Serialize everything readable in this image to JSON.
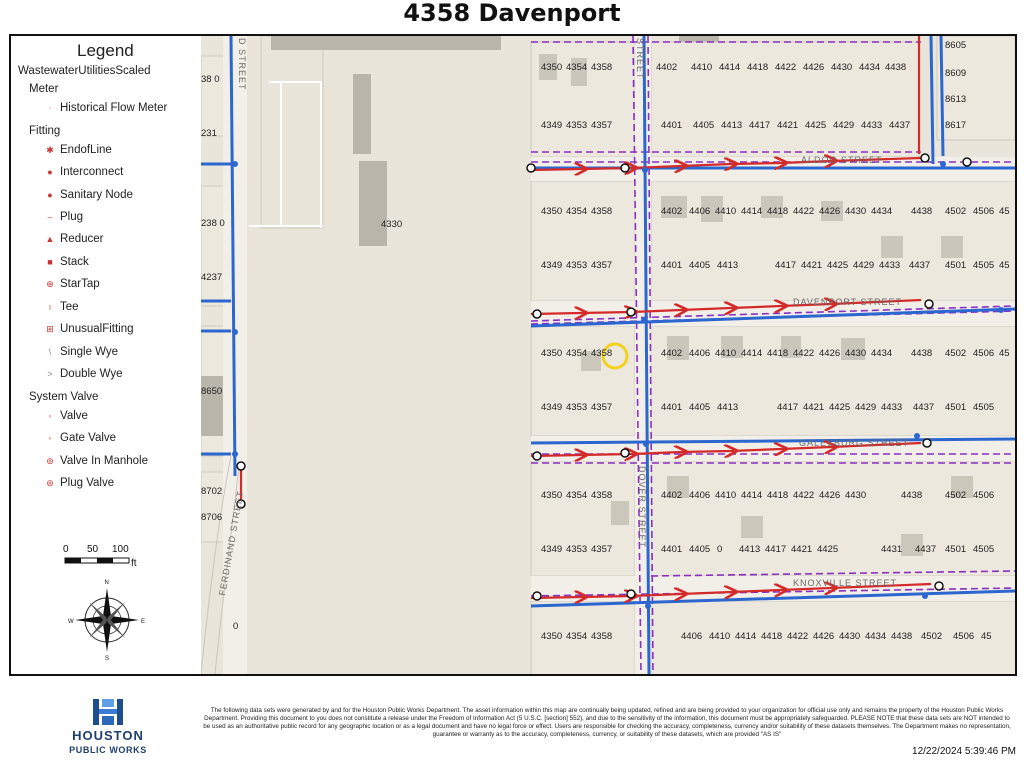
{
  "title": "4358 Davenport",
  "legend": {
    "heading": "Legend",
    "layer": "WastewaterUtilitiesScaled",
    "groups": [
      {
        "name": "Meter",
        "items": [
          "Historical Flow Meter"
        ]
      },
      {
        "name": "Fitting",
        "items": [
          "EndofLine",
          "Interconnect",
          "Sanitary Node",
          "Plug",
          "Reducer",
          "Stack",
          "StarTap",
          "Tee",
          "UnusualFitting",
          "Single Wye",
          "Double Wye"
        ]
      },
      {
        "name": "System Valve",
        "items": [
          "Valve",
          "Gate Valve",
          "Valve In Manhole",
          "Plug Valve"
        ]
      }
    ],
    "scale": {
      "t0": "0",
      "t50": "50",
      "t100": "100",
      "unit": "ft"
    },
    "compass": {
      "n": "N",
      "s": "S",
      "e": "E",
      "w": "W"
    }
  },
  "streets": {
    "aldoo": "ALDOO STREET",
    "davenport": "DAVENPORT STREET",
    "galesburg": "GALESBURG STREET",
    "knoxville": "KNOXVILLE STREET",
    "ferdinand": "FERDINAND STREET",
    "ferdinand_top": "D STREET",
    "cross": "STREET",
    "cross2": "DOVER STREET"
  },
  "parcels": {
    "left_col": [
      "38 0",
      "231",
      "238 0",
      "4237",
      "8650",
      "8702",
      "8706"
    ],
    "center": "4330",
    "bottom_left": "0",
    "right_col": [
      "8605",
      "8609",
      "8613",
      "8617"
    ],
    "row1": [
      "4350",
      "4354",
      "4358",
      "4402",
      "4410",
      "4414",
      "4418",
      "4422",
      "4426",
      "4430",
      "4434",
      "4438"
    ],
    "row2": [
      "4349",
      "4353",
      "4357",
      "4401",
      "4405",
      "4413",
      "4417",
      "4421",
      "4425",
      "4429",
      "4433",
      "4437"
    ],
    "row3": [
      "4350",
      "4354",
      "4358",
      "4402",
      "4406",
      "4410",
      "4414",
      "4418",
      "4422",
      "4426",
      "4430",
      "4434",
      "4438",
      "4502",
      "4506",
      "45"
    ],
    "row4": [
      "4349",
      "4353",
      "4357",
      "4401",
      "4405",
      "4413",
      "4417",
      "4421",
      "4425",
      "4429",
      "4433",
      "4437",
      "4501",
      "4505",
      "45"
    ],
    "row5": [
      "4350",
      "4354",
      "4358",
      "4402",
      "4406",
      "4410",
      "4414",
      "4418",
      "4422",
      "4426",
      "4430",
      "4434",
      "4438",
      "4502",
      "4506",
      "45"
    ],
    "row6": [
      "4349",
      "4353",
      "4357",
      "4401",
      "4405",
      "4413",
      "4417",
      "4421",
      "4425",
      "4429",
      "4433",
      "4437",
      "4501",
      "4505"
    ],
    "row7": [
      "4350",
      "4354",
      "4358",
      "4402",
      "4406",
      "4410",
      "4414",
      "4418",
      "4422",
      "4426",
      "4430",
      "4438",
      "4502",
      "4506"
    ],
    "row8": [
      "4349",
      "4353",
      "4357",
      "4401",
      "4405",
      "0",
      "4413",
      "4417",
      "4421",
      "4425",
      "4431",
      "4437",
      "4501",
      "4505"
    ],
    "row9": [
      "4350",
      "4354",
      "4358",
      "4406",
      "4410",
      "4414",
      "4418",
      "4422",
      "4426",
      "4430",
      "4434",
      "4438",
      "4502",
      "4506",
      "45"
    ]
  },
  "colors": {
    "ground": "#e9e5da",
    "lot": "#ede9df",
    "building": "#b9b5aa",
    "red_line": "#d32a2a",
    "blue_line": "#2c67cf",
    "purple_dash": "#8a2fc4",
    "highlight": "#f2d21c"
  },
  "footer": {
    "logo_top": "HOUSTON",
    "logo_bottom": "PUBLIC WORKS",
    "disclaimer": "The following data sets were generated by and for the Houston Public Works Department. The asset information within this map are continually being updated, refined and are being provided to your organization for official use only and remains the property of the Houston Public Works Department. Providing this document to you does not constitute a release under the Freedom of Information Act (5 U.S.C. [section] 552), and due to the sensitivity of the information, this document must be appropriately safeguarded. PLEASE NOTE that these data sets are NOT intended to be used as an authoritative public record for any geographic location or as a legal document and have no legal force or effect. Users are responsible for checking the accuracy, completeness, currency and/or suitability of these datasets themselves. The Department makes no representation, guarantee or warranty as to the accuracy, completeness, currency, or suitability of these datasets, which are provided \"AS IS\"",
    "timestamp": "12/22/2024 5:39:46 PM"
  }
}
